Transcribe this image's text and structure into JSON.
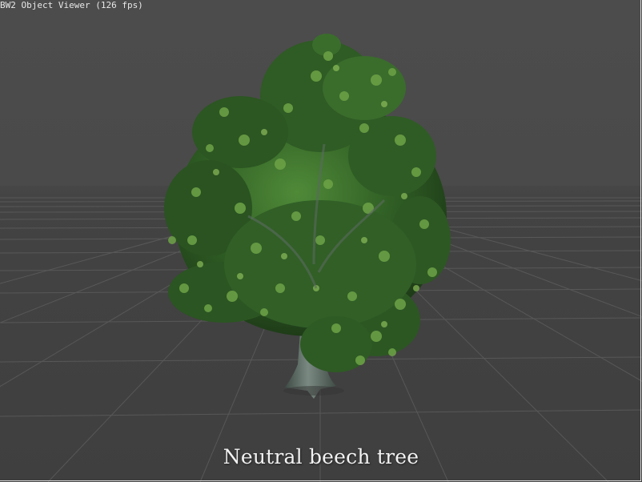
{
  "window": {
    "title_overlay": "BW2 Object Viewer (126 fps)"
  },
  "viewer": {
    "caption": "Neutral beech  tree",
    "background_color": "#4a4a4a",
    "grid_color": "#5e5e5e",
    "foliage_colors": [
      "#1f3f19",
      "#2d5a24",
      "#3f7a30",
      "#5f9a3f",
      "#7fb04f"
    ],
    "trunk_color": "#55605a"
  }
}
